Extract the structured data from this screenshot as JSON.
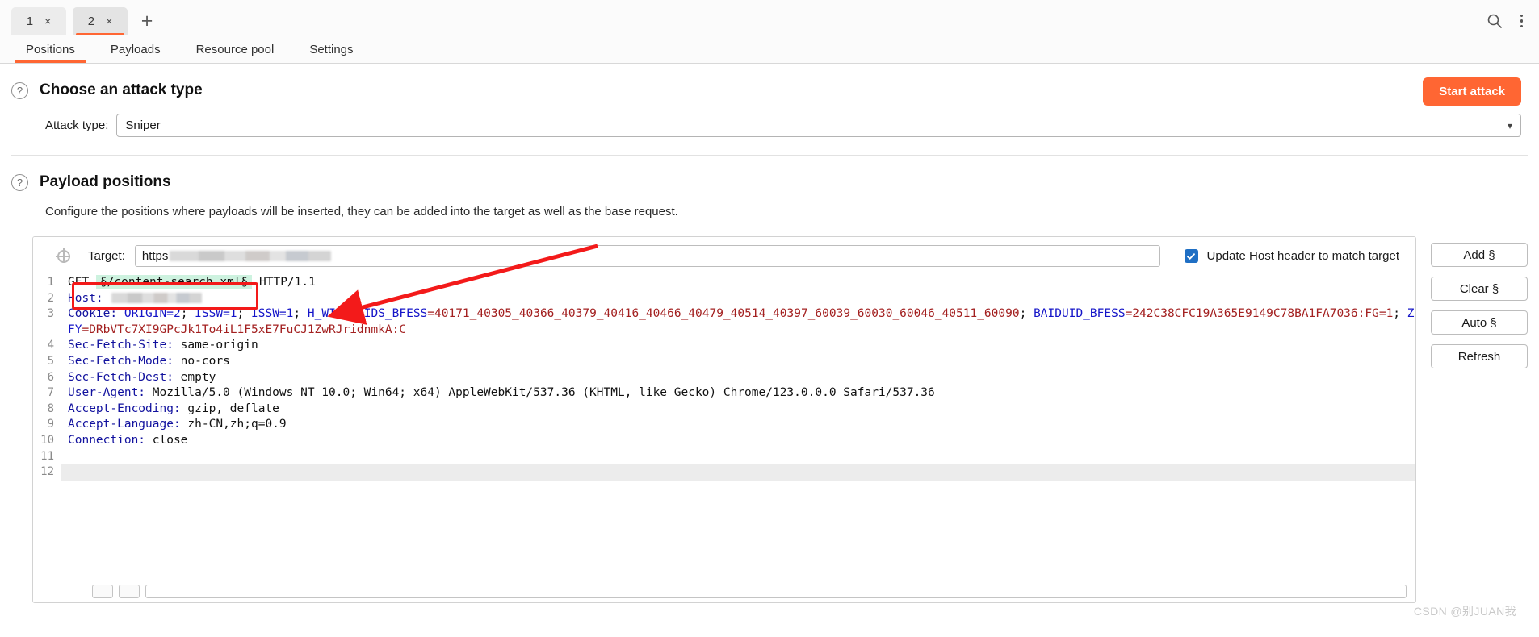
{
  "window": {
    "tabs": [
      {
        "label": "1",
        "active": false,
        "close": "×"
      },
      {
        "label": "2",
        "active": true,
        "close": "×"
      }
    ],
    "add_tab": "+",
    "search_icon": "search-icon",
    "menu_icon": "kebab-menu-icon"
  },
  "subnav": {
    "items": [
      {
        "label": "Positions",
        "active": true
      },
      {
        "label": "Payloads",
        "active": false
      },
      {
        "label": "Resource pool",
        "active": false
      },
      {
        "label": "Settings",
        "active": false
      }
    ]
  },
  "attack_type_section": {
    "help": "?",
    "title": "Choose an attack type",
    "label": "Attack type:",
    "value": "Sniper",
    "chevron": "▾",
    "start_button": "Start attack",
    "accent_color": "#ff6633"
  },
  "payload_positions_section": {
    "help": "?",
    "title": "Payload positions",
    "description": "Configure the positions where payloads will be inserted, they can be added into the target as well as the base request."
  },
  "target": {
    "label": "Target:",
    "value": "https",
    "placeholder": "https://",
    "checkbox_label": "Update Host header to match target",
    "checkbox_checked": true,
    "checkbox_color": "#1f6fc4"
  },
  "side_buttons": [
    {
      "label": "Add §"
    },
    {
      "label": "Clear §"
    },
    {
      "label": "Auto §"
    },
    {
      "label": "Refresh"
    }
  ],
  "request": {
    "lines": [
      {
        "n": "1"
      },
      {
        "n": "2"
      },
      {
        "n": "3"
      },
      {
        "n": ""
      },
      {
        "n": "4"
      },
      {
        "n": "5"
      },
      {
        "n": "6"
      },
      {
        "n": "7"
      },
      {
        "n": "8"
      },
      {
        "n": "9"
      },
      {
        "n": "10"
      },
      {
        "n": "11"
      },
      {
        "n": "12"
      }
    ],
    "line1": {
      "method": "GET",
      "highlighted": "§/content-search.xml§",
      "version": "HTTP/1.1"
    },
    "line2": {
      "name": "Host:",
      "value": ""
    },
    "line3": {
      "name": "Cookie:",
      "seg1": "ORIGIN=2",
      "sep1": "; ",
      "seg2": "ISSW=1",
      "sep2": "; ",
      "seg3": "ISSW=1",
      "sep3": "; ",
      "seg4": "H_WISE_SIDS_BFESS",
      "seg4val": "=40171_40305_40366_40379_40416_40466_40479_40514_40397_60039_60030_60046_40511_60090",
      "sep4": "; ",
      "seg5": "BAIDUID_BFESS",
      "seg5val": "=242C38CFC19A365E9149C78BA1FA7036:FG=1",
      "sep5": "; ",
      "seg6": "ZFY",
      "seg6val": "=DRbVTc7XI9GPcJk1To4iL1F5xE7FuCJ1ZwRJridnmkA:C"
    },
    "line4": {
      "name": "Sec-Fetch-Site:",
      "value": " same-origin"
    },
    "line5": {
      "name": "Sec-Fetch-Mode:",
      "value": " no-cors"
    },
    "line6": {
      "name": "Sec-Fetch-Dest:",
      "value": " empty"
    },
    "line7": {
      "name": "User-Agent:",
      "value": " Mozilla/5.0 (Windows NT 10.0; Win64; x64) AppleWebKit/537.36 (KHTML, like Gecko) Chrome/123.0.0.0 Safari/537.36"
    },
    "line8": {
      "name": "Accept-Encoding:",
      "value": " gzip, deflate"
    },
    "line9": {
      "name": "Accept-Language:",
      "value": " zh-CN,zh;q=0.9"
    },
    "line10": {
      "name": "Connection:",
      "value": " close"
    }
  },
  "annotation": {
    "color": "#f31a1a",
    "shape": "arrow-and-box"
  },
  "watermark": "CSDN @别JUAN我"
}
